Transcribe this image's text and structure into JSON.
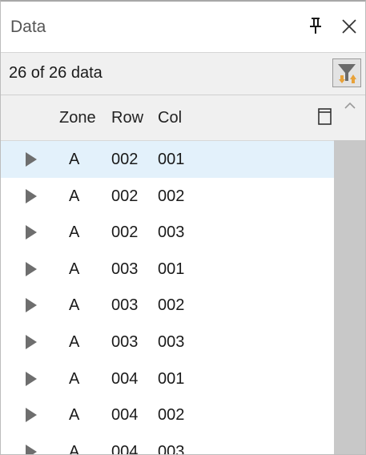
{
  "panel": {
    "title": "Data",
    "pin_icon": "pin-icon",
    "close_icon": "close-icon"
  },
  "toolbar": {
    "count_text": "26 of 26 data",
    "filter_icon": "filter-sort-icon"
  },
  "table": {
    "columns": [
      "Zone",
      "Row",
      "Col"
    ],
    "column_chooser_icon": "column-chooser-icon",
    "rows": [
      {
        "zone": "A",
        "row": "002",
        "col": "001"
      },
      {
        "zone": "A",
        "row": "002",
        "col": "002"
      },
      {
        "zone": "A",
        "row": "002",
        "col": "003"
      },
      {
        "zone": "A",
        "row": "003",
        "col": "001"
      },
      {
        "zone": "A",
        "row": "003",
        "col": "002"
      },
      {
        "zone": "A",
        "row": "003",
        "col": "003"
      },
      {
        "zone": "A",
        "row": "004",
        "col": "001"
      },
      {
        "zone": "A",
        "row": "004",
        "col": "002"
      },
      {
        "zone": "A",
        "row": "004",
        "col": "003"
      }
    ],
    "selected_index": 0
  },
  "colors": {
    "selected_row": "#e3f1fb",
    "header_bg": "#f0f0f0",
    "filter_arrow_down": "#e8a23a",
    "filter_arrow_up": "#e8a23a",
    "filter_funnel": "#6b6b6b",
    "scroll_thumb": "#c8c8c8"
  }
}
